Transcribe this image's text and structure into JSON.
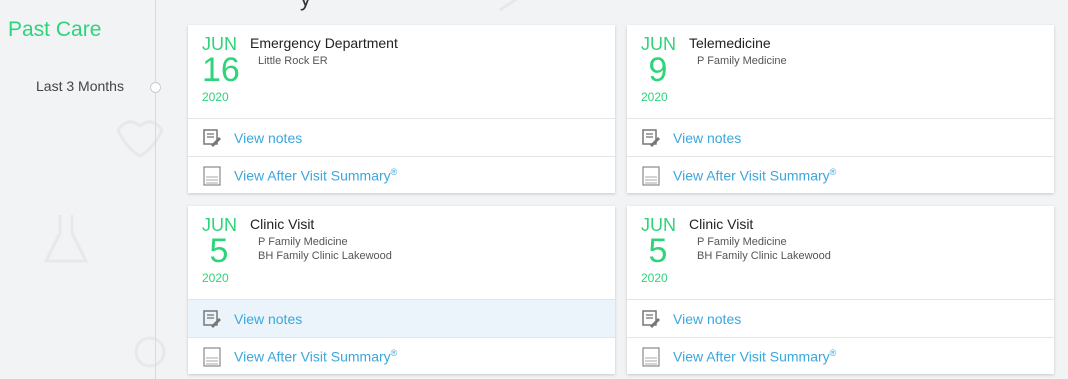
{
  "page": {
    "section_title": "Past Care",
    "clipped_header_fragment": "y"
  },
  "timeline": {
    "label": "Last 3 Months"
  },
  "visits": [
    {
      "month": "JUN",
      "day": "16",
      "year": "2020",
      "title": "Emergency Department",
      "sub1": "Little Rock ER",
      "sub2": "",
      "notes_label": "View notes",
      "avs_label": "View After Visit Summary",
      "avs_mark": "®",
      "notes_highlighted": false
    },
    {
      "month": "JUN",
      "day": "9",
      "year": "2020",
      "title": "Telemedicine",
      "sub1": "P Family Medicine",
      "sub2": "",
      "notes_label": "View notes",
      "avs_label": "View After Visit Summary",
      "avs_mark": "®",
      "notes_highlighted": false
    },
    {
      "month": "JUN",
      "day": "5",
      "year": "2020",
      "title": "Clinic Visit",
      "sub1": "P Family Medicine",
      "sub2": "BH Family Clinic Lakewood",
      "notes_label": "View notes",
      "avs_label": "View After Visit Summary",
      "avs_mark": "®",
      "notes_highlighted": true
    },
    {
      "month": "JUN",
      "day": "5",
      "year": "2020",
      "title": "Clinic Visit",
      "sub1": "P Family Medicine",
      "sub2": "BH Family Clinic Lakewood",
      "notes_label": "View notes",
      "avs_label": "View After Visit Summary",
      "avs_mark": "®",
      "notes_highlighted": false
    }
  ],
  "icons": {
    "notes": "notes-pencil-icon",
    "avs": "avs-document-icon"
  },
  "colors": {
    "accent_green": "#2ed47a",
    "link_blue": "#3ba7dc",
    "highlight_row": "#eaf4fa"
  }
}
